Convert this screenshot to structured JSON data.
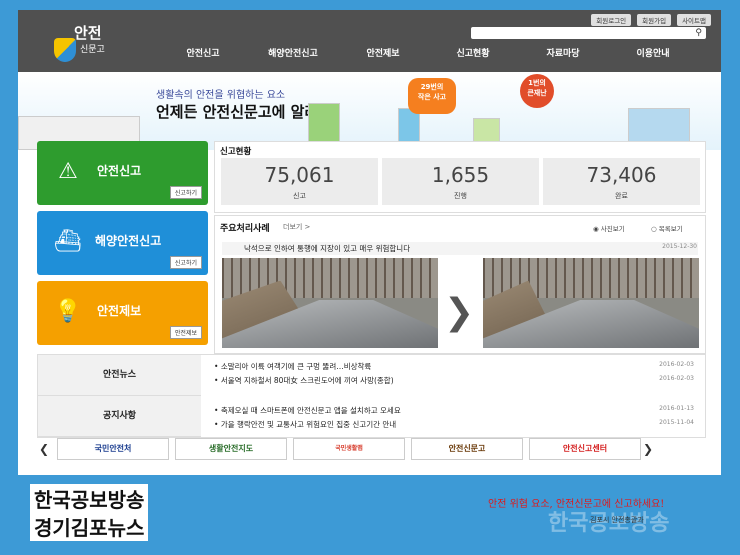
{
  "header": {
    "logo_top": "안전",
    "logo_bottom": "신문고",
    "util": [
      "회원로그인",
      "회원가입",
      "사이트맵"
    ],
    "search_icon": "search-icon",
    "nav": [
      "안전신고",
      "해양안전신고",
      "안전제보",
      "신고현황",
      "자료마당",
      "이용안내"
    ]
  },
  "banner": {
    "line1": "생활속의 안전을 위협하는 요소",
    "line2": "언제든 안전신문고에 알려요",
    "bubble1_top": "29번의",
    "bubble1_bottom": "작은 사고",
    "bubble2_top": "1번의",
    "bubble2_bottom": "큰재난"
  },
  "quick": [
    {
      "label": "안전신고",
      "button": "신고하기",
      "color": "#2e9c2e"
    },
    {
      "label": "해양안전신고",
      "button": "신고하기",
      "color": "#1f8fd8"
    },
    {
      "label": "안전제보",
      "button": "안전제보",
      "color": "#f5a000"
    }
  ],
  "stats": {
    "title": "신고현황",
    "items": [
      {
        "value": "75,061",
        "label": "신고"
      },
      {
        "value": "1,655",
        "label": "진행"
      },
      {
        "value": "73,406",
        "label": "완료"
      }
    ]
  },
  "cases": {
    "title": "주요처리사례",
    "more": "더보기 >",
    "opt_photo": "사진보기",
    "opt_list": "목록보기",
    "headline": "낙석으로 인하여 통행에 지장이 있고 매우 위험합니다",
    "date": "2015-12-30"
  },
  "news": {
    "tab1": "안전뉴스",
    "tab2": "공지사항",
    "items1": [
      {
        "text": "소말리아 이륙 여객기에 큰 구멍 뚫려…비상착륙",
        "date": "2016-02-03"
      },
      {
        "text": "서울역 지하철서 80대女 스크린도어에 끼여 사망(종합)",
        "date": "2016-02-03"
      }
    ],
    "items2": [
      {
        "text": "축제오실 때 스마트폰에 안전신문고 앱을 설치하고 오세요",
        "date": "2016-01-13"
      },
      {
        "text": "가을 행락안전 및 교통사고 위험요인 집중 신고기간 안내",
        "date": "2015-11-04"
      }
    ]
  },
  "partners": [
    "국민안전처",
    "생활안전지도",
    "국민생활맵",
    "안전신문고",
    "안전신고센터"
  ],
  "watermark": {
    "line1": "한국공보방송",
    "line2": "경기김포뉴스",
    "caption": "안전 위협 요소, 안전신문고에 신고하세요!",
    "signature": "김포시 안전총괄과",
    "ghost": "한국공보방송"
  }
}
